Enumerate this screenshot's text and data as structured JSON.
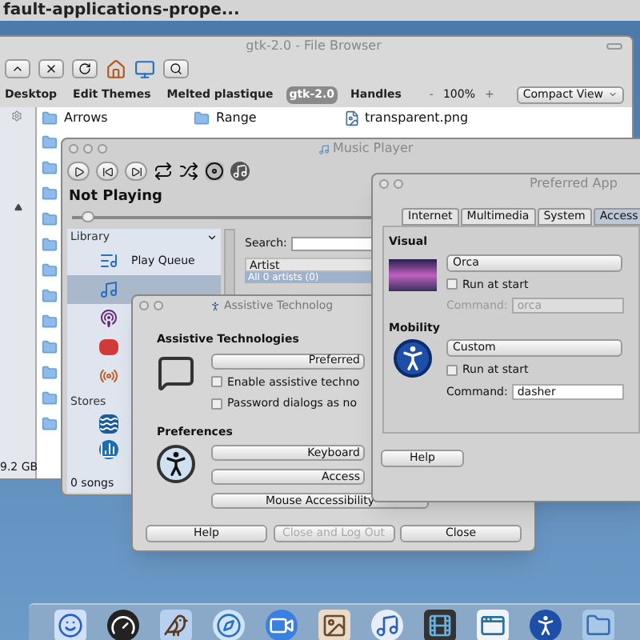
{
  "top_bar": {
    "title": "fault-applications-prope..."
  },
  "file_browser": {
    "title": "gtk-2.0 - File Browser",
    "zoom_minus": "-",
    "zoom": "100%",
    "zoom_plus": "+",
    "view": "Compact View",
    "bookmarks": [
      {
        "label": "Desktop",
        "selected": false
      },
      {
        "label": "Edit Themes",
        "selected": false
      },
      {
        "label": "Melted plastique",
        "selected": false
      },
      {
        "label": "gtk-2.0",
        "selected": true
      },
      {
        "label": "Handles",
        "selected": false
      }
    ],
    "files": [
      {
        "name": "Arrows",
        "kind": "folder"
      },
      {
        "name": "Range",
        "kind": "folder"
      },
      {
        "name": "transparent.png",
        "kind": "image"
      }
    ],
    "free_space": "9.2 GB"
  },
  "music_player": {
    "title": "Music Player",
    "status": "Not Playing",
    "position": {
      "level": 0.02
    },
    "library_heading": "Library",
    "library": [
      {
        "kind": "queue",
        "label": "Play Queue",
        "selected": false
      },
      {
        "kind": "music",
        "selected": true
      },
      {
        "kind": "podcast",
        "selected": false
      },
      {
        "kind": "lastfm",
        "selected": false
      },
      {
        "kind": "radio",
        "selected": false
      }
    ],
    "stores_heading": "Stores",
    "stores": [
      {
        "kind": "wave"
      },
      {
        "kind": "bars"
      }
    ],
    "song_count": "0 songs",
    "search_label": "Search:",
    "column": "Artist",
    "rows": [
      "All 0 artists (0)"
    ]
  },
  "assistive": {
    "title": "Assistive Technolog",
    "heading": "Assistive Technologies",
    "preferred_button": "Preferred",
    "options": [
      {
        "label": "Enable assistive techno",
        "checked": false
      },
      {
        "label": "Password dialogs as no",
        "checked": false
      }
    ],
    "prefs_heading": "Preferences",
    "pref_buttons": [
      "Keyboard",
      "Access",
      "Mouse Accessibility"
    ],
    "footer": [
      {
        "label": "Help",
        "disabled": false
      },
      {
        "label": "Close and Log Out",
        "disabled": true
      },
      {
        "label": "Close",
        "disabled": false
      }
    ]
  },
  "preferred": {
    "title": "Preferred App",
    "tabs": [
      {
        "label": "Internet",
        "selected": false
      },
      {
        "label": "Multimedia",
        "selected": false
      },
      {
        "label": "System",
        "selected": false
      },
      {
        "label": "Access",
        "selected": true
      }
    ],
    "sections": [
      {
        "kind": "visual",
        "heading": "Visual",
        "app": "Orca",
        "run_label": "Run at start",
        "run_checked": false,
        "command_label": "Command:",
        "command": "orca",
        "disabled": true
      },
      {
        "kind": "mobility",
        "heading": "Mobility",
        "app": "Custom",
        "run_label": "Run at start",
        "run_checked": false,
        "command_label": "Command:",
        "command": "dasher",
        "disabled": false
      }
    ],
    "help": "Help"
  }
}
